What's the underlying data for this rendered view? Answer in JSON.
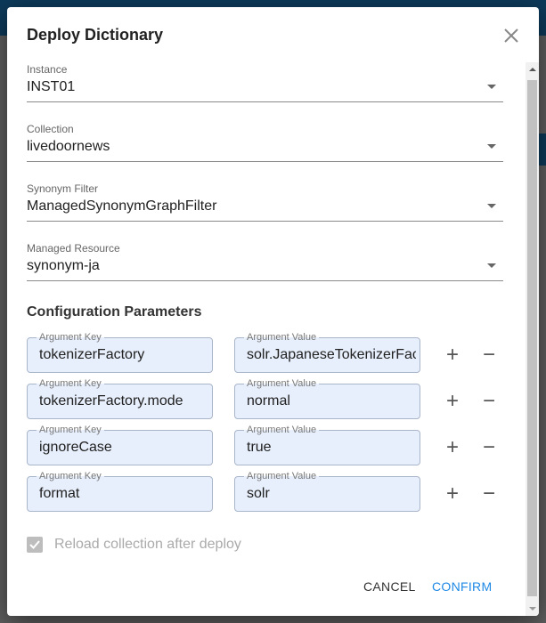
{
  "dialog": {
    "title": "Deploy Dictionary"
  },
  "selects": [
    {
      "label": "Instance",
      "value": "INST01"
    },
    {
      "label": "Collection",
      "value": "livedoornews"
    },
    {
      "label": "Synonym Filter",
      "value": "ManagedSynonymGraphFilter"
    },
    {
      "label": "Managed Resource",
      "value": "synonym-ja"
    }
  ],
  "config": {
    "title": "Configuration Parameters",
    "key_label": "Argument Key",
    "value_label": "Argument Value",
    "rows": [
      {
        "key": "tokenizerFactory",
        "value": "solr.JapaneseTokenizerFactory"
      },
      {
        "key": "tokenizerFactory.mode",
        "value": "normal"
      },
      {
        "key": "ignoreCase",
        "value": "true"
      },
      {
        "key": "format",
        "value": "solr"
      }
    ]
  },
  "reload": {
    "label": "Reload collection after deploy",
    "checked": true,
    "disabled": true
  },
  "actions": {
    "cancel": "CANCEL",
    "confirm": "CONFIRM"
  },
  "colors": {
    "accent": "#1e88e5",
    "field_bg": "#e8effc"
  },
  "icons": {
    "add": "+",
    "remove": "−",
    "close": "×"
  }
}
